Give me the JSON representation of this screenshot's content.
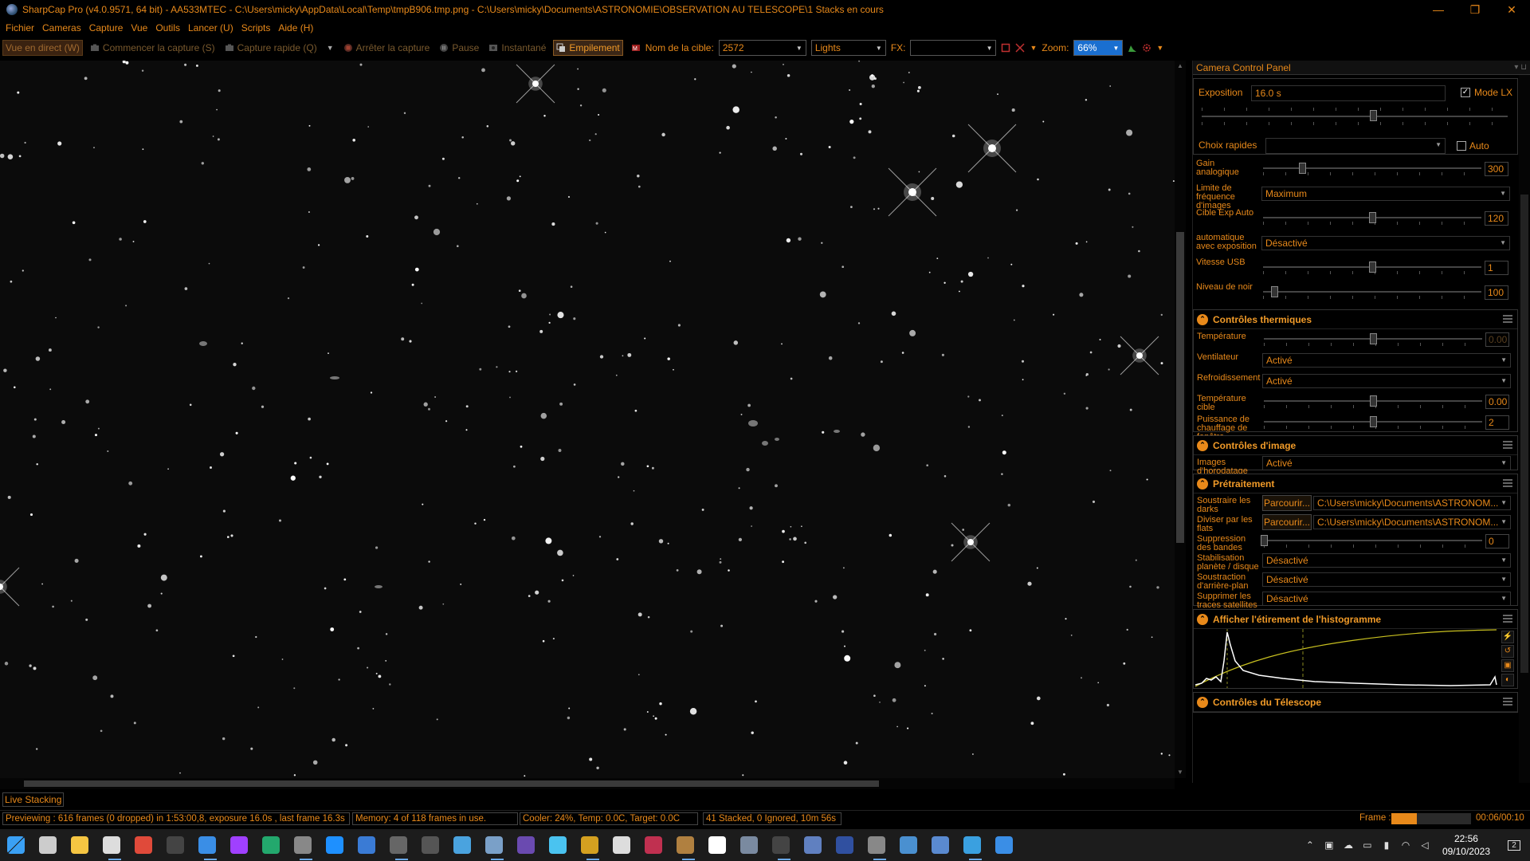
{
  "window": {
    "title": "SharpCap Pro (v4.0.9571, 64 bit) - AA533MTEC - C:\\Users\\micky\\AppData\\Local\\Temp\\tmpB906.tmp.png - C:\\Users\\micky\\Documents\\ASTRONOMIE\\OBSERVATION AU TELESCOPE\\1 Stacks en cours",
    "minimize": "—",
    "maximize": "❐",
    "close": "✕"
  },
  "menu": [
    "Fichier",
    "Cameras",
    "Capture",
    "Vue",
    "Outils",
    "Lancer (U)",
    "Scripts",
    "Aide (H)"
  ],
  "toolbar": {
    "live_view": "Vue en direct (W)",
    "start_capture": "Commencer la capture (S)",
    "quick_capture": "Capture rapide (Q)",
    "stop_capture": "Arrêter la capture",
    "pause": "Pause",
    "snapshot": "Instantané",
    "stacking": "Empilement",
    "target_label": "Nom de la cible:",
    "target_value": "2572",
    "frame_type": "Lights",
    "fx_label": "FX:",
    "fx_value": "",
    "zoom_label": "Zoom:",
    "zoom_value": "66%"
  },
  "panel": {
    "title": "Camera Control Panel",
    "exposure": {
      "label": "Exposition",
      "value": "16.0 s",
      "lx_label": "Mode LX",
      "lx_checked": true,
      "quick_label": "Choix rapides",
      "quick_value": "",
      "auto_label": "Auto",
      "slider": 0.56
    },
    "camera_rows": [
      {
        "label": "Gain analogique",
        "type": "slider",
        "value": "300",
        "pos": 0.18
      },
      {
        "label": "Limite de fréquence d'images",
        "type": "dropdown",
        "value": "Maximum"
      },
      {
        "label": "Cible Exp Auto",
        "type": "slider",
        "value": "120",
        "pos": 0.5
      },
      {
        "label": "automatique avec exposition",
        "type": "dropdown",
        "value": "Désactivé"
      },
      {
        "label": "Vitesse USB",
        "type": "slider",
        "value": "1",
        "pos": 0.5
      },
      {
        "label": "Niveau de noir",
        "type": "slider",
        "value": "100",
        "pos": 0.05
      }
    ],
    "thermal": {
      "title": "Contrôles thermiques",
      "rows": [
        {
          "label": "Température",
          "type": "slider",
          "value": "0.00",
          "pos": 0.5,
          "dim": true
        },
        {
          "label": "Ventilateur",
          "type": "dropdown",
          "value": "Activé"
        },
        {
          "label": "Refroidissement",
          "type": "dropdown",
          "value": "Activé"
        },
        {
          "label": "Température cible",
          "type": "slider",
          "value": "0.00",
          "pos": 0.5
        },
        {
          "label": "Puissance de chauffage de fenêtre",
          "type": "slider",
          "value": "2",
          "pos": 0.5
        }
      ]
    },
    "image": {
      "title": "Contrôles d'image",
      "rows": [
        {
          "label": "Images d'horodatage",
          "type": "dropdown",
          "value": "Activé"
        }
      ]
    },
    "preprocessing": {
      "title": "Prétraitement",
      "browse": "Parcourir...",
      "rows": [
        {
          "label": "Soustraire les darks",
          "type": "file",
          "value": "C:\\Users\\micky\\Documents\\ASTRONOM..."
        },
        {
          "label": "Diviser par les flats",
          "type": "file",
          "value": "C:\\Users\\micky\\Documents\\ASTRONOM..."
        },
        {
          "label": "Suppression des bandes",
          "type": "slider",
          "value": "0",
          "pos": 0.0
        },
        {
          "label": "Stabilisation planète / disque",
          "type": "dropdown",
          "value": "Désactivé"
        },
        {
          "label": "Soustraction d'arrière-plan",
          "type": "dropdown",
          "value": "Désactivé"
        },
        {
          "label": "Supprimer les traces satellites",
          "type": "dropdown",
          "value": "Désactivé"
        }
      ]
    },
    "histogram": {
      "title": "Afficher l'étirement de l'histogramme"
    },
    "telescope": {
      "title": "Contrôles du Télescope"
    }
  },
  "status": {
    "live_tab": "Live Stacking",
    "preview": "Previewing : 616 frames (0 dropped) in 1:53:00,8, exposure 16.0s , last frame 16.3s",
    "memory": "Memory: 4 of 118 frames in use.",
    "cooler": "Cooler: 24%, Temp: 0.0C, Target: 0.0C",
    "stacked": "41 Stacked, 0 Ignored, 10m 56s",
    "frame_label": "Frame :",
    "frame_progress": 0.32,
    "frame_time": "00:06/00:10"
  },
  "taskbar": {
    "time": "22:56",
    "date": "09/10/2023",
    "notifications": "2",
    "apps": [
      {
        "name": "windows-start-icon",
        "color": "#2a9df4"
      },
      {
        "name": "task-view-icon",
        "color": "#cccccc"
      },
      {
        "name": "file-explorer-icon",
        "color": "#f5c542"
      },
      {
        "name": "settings-icon",
        "color": "#dddddd"
      },
      {
        "name": "app-red-icon",
        "color": "#e04a3a"
      },
      {
        "name": "notion-icon",
        "color": "#444444"
      },
      {
        "name": "mail-icon",
        "color": "#3a8ee6"
      },
      {
        "name": "messenger-icon",
        "color": "#a040ff"
      },
      {
        "name": "edge-icon",
        "color": "#23a86d"
      },
      {
        "name": "app-globe-icon",
        "color": "#888888"
      },
      {
        "name": "app-blue-icon",
        "color": "#1e90ff"
      },
      {
        "name": "app-v-icon",
        "color": "#3a7bd5"
      },
      {
        "name": "app-grid-icon",
        "color": "#666666"
      },
      {
        "name": "app-dark-icon",
        "color": "#555555"
      },
      {
        "name": "app-pix-icon",
        "color": "#4aa3df"
      },
      {
        "name": "sharpcap-icon",
        "color": "#7aa0c8"
      },
      {
        "name": "app-purple-icon",
        "color": "#6a4ab0"
      },
      {
        "name": "app-star-icon",
        "color": "#4ac3f0"
      },
      {
        "name": "app-multi-icon",
        "color": "#d4a020"
      },
      {
        "name": "app-square-icon",
        "color": "#dddddd"
      },
      {
        "name": "app-orbit-icon",
        "color": "#c03050"
      },
      {
        "name": "app-planets-icon",
        "color": "#b08040"
      },
      {
        "name": "app-ring-icon",
        "color": "#ffffff"
      },
      {
        "name": "app-tools-icon",
        "color": "#7a8aa0"
      },
      {
        "name": "app-f-icon",
        "color": "#444444"
      },
      {
        "name": "app-star2-icon",
        "color": "#6080c0"
      },
      {
        "name": "app-nasa-icon",
        "color": "#3050a0"
      },
      {
        "name": "app-cam-icon",
        "color": "#888888"
      },
      {
        "name": "app-astro-icon",
        "color": "#4a90d0"
      },
      {
        "name": "app-puzzle-icon",
        "color": "#5a8ad0"
      },
      {
        "name": "app-grid2-icon",
        "color": "#3aa0e0"
      },
      {
        "name": "app-chart-icon",
        "color": "#3a8ee6"
      }
    ]
  }
}
